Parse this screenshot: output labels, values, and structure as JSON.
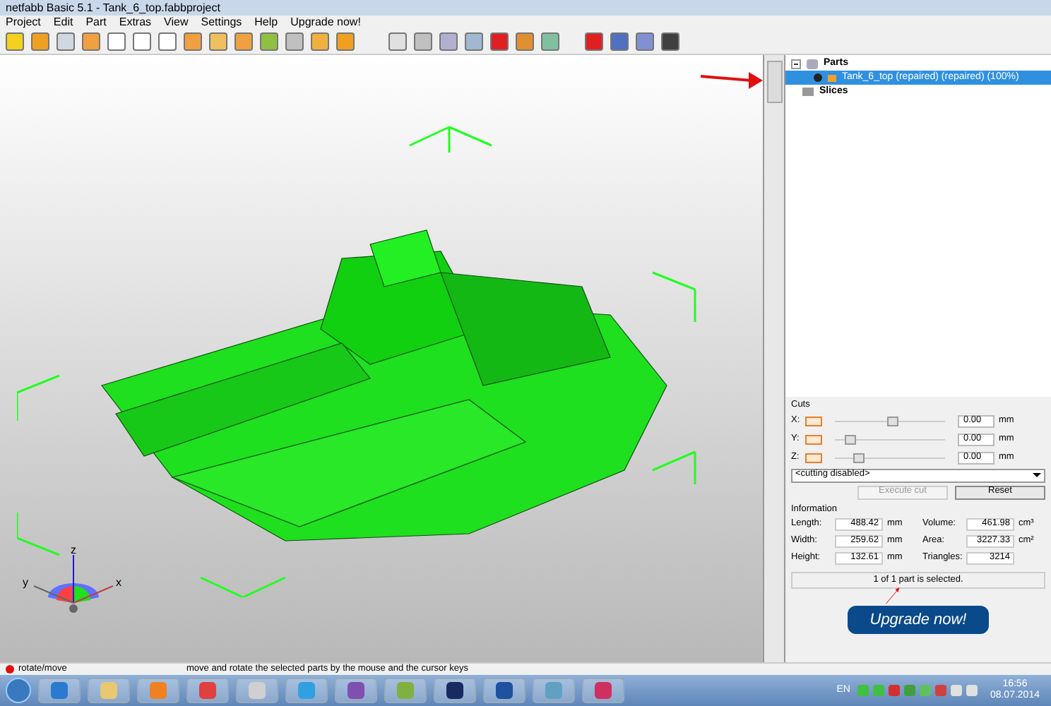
{
  "window": {
    "title": "netfabb Basic 5.1 - Tank_6_top.fabbproject"
  },
  "menu": [
    "Project",
    "Edit",
    "Part",
    "Extras",
    "View",
    "Settings",
    "Help",
    "Upgrade now!"
  ],
  "tree": {
    "parts": {
      "label": "Parts",
      "expanded": true,
      "children": [
        {
          "label": "Tank_6_top (repaired) (repaired) (100%)",
          "selected": true
        }
      ]
    },
    "slices": {
      "label": "Slices"
    }
  },
  "cuts": {
    "title": "Cuts",
    "axes": [
      {
        "label": "X:",
        "checked": false,
        "level": 0.53,
        "value": "0.00",
        "unit": "mm"
      },
      {
        "label": "Y:",
        "checked": false,
        "level": 0.1,
        "value": "0.00",
        "unit": "mm"
      },
      {
        "label": "Z:",
        "checked": false,
        "level": 0.18,
        "value": "0.00",
        "unit": "mm"
      }
    ],
    "mode": "<cutting disabled>",
    "buttons": [
      {
        "label": "Execute cut",
        "disabled": true
      },
      {
        "label": "Reset",
        "disabled": false
      }
    ]
  },
  "information": {
    "title": "Information",
    "fields": [
      {
        "label": "Length:",
        "value": "488.42",
        "unit": "mm"
      },
      {
        "label": "Volume:",
        "value": "461.98",
        "unit": "cm³"
      },
      {
        "label": "Width:",
        "value": "259.62",
        "unit": "mm"
      },
      {
        "label": "Area:",
        "value": "3227.33",
        "unit": "cm²"
      },
      {
        "label": "Height:",
        "value": "132.61",
        "unit": "mm"
      },
      {
        "label": "Triangles:",
        "value": "3214"
      }
    ]
  },
  "selection_status": "1 of 1 part is selected.",
  "upgrade_button": "Upgrade now!",
  "gizmo_axes": {
    "z": "z",
    "y": "y",
    "x": "x"
  },
  "status_bar": {
    "mode": "rotate/move",
    "hint": "move and rotate the selected parts by the mouse and the cursor keys"
  },
  "taskbar": {
    "language": "EN",
    "time": "16:56",
    "date": "08.07.2014"
  }
}
